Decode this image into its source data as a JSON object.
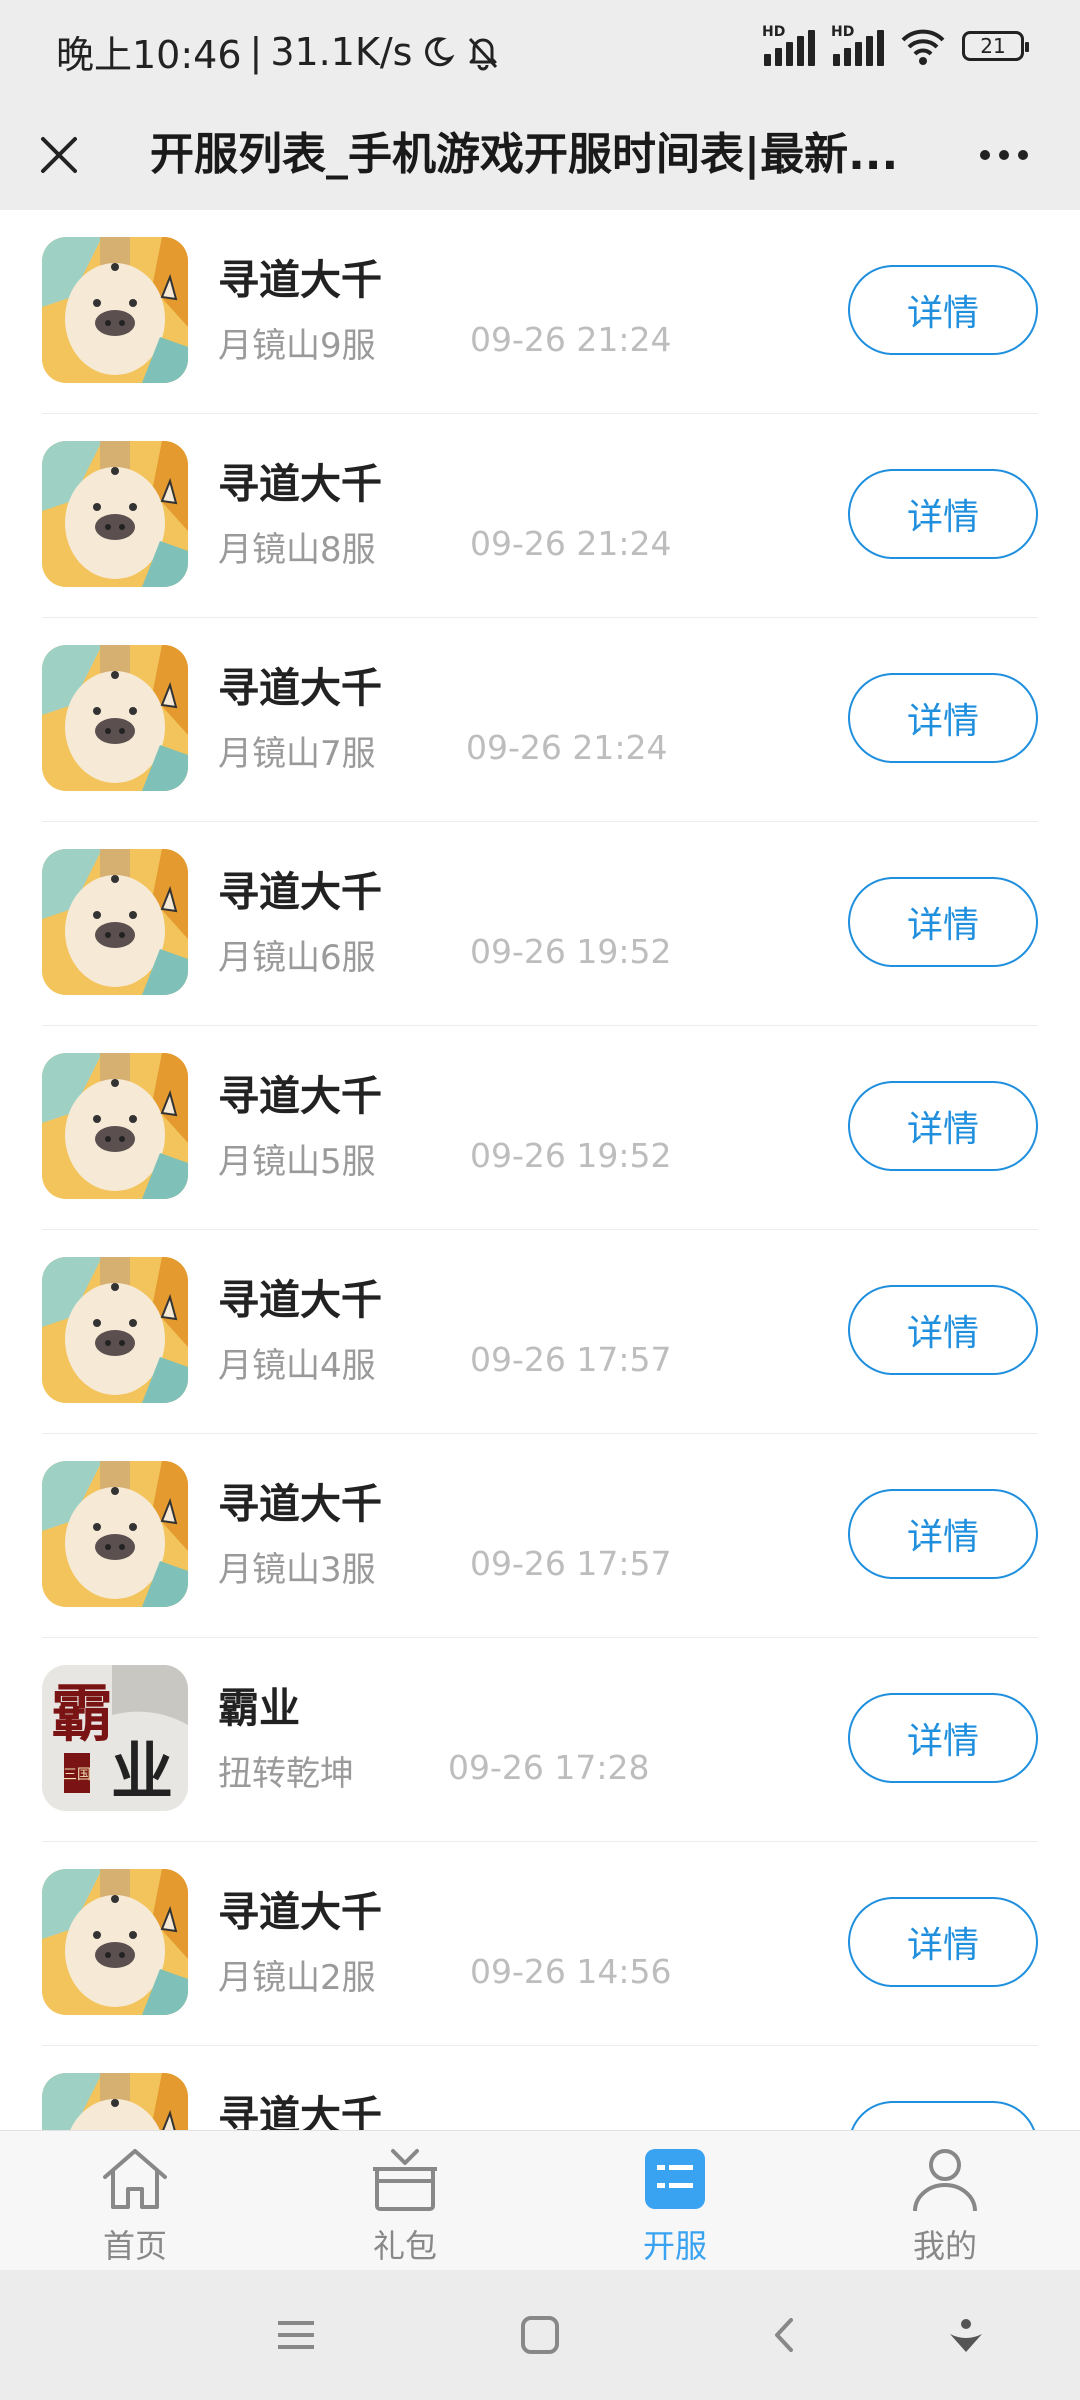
{
  "status_bar": {
    "time": "晚上10:46",
    "separator": "|",
    "net_speed": "31.1K/s",
    "signal_label_1": "HD",
    "signal_label_2": "HD",
    "battery": "21"
  },
  "title_bar": {
    "title": "开服列表_手机游戏开服时间表|最新..."
  },
  "list": {
    "detail_label": "详情",
    "items": [
      {
        "name": "寻道大千",
        "server": "月镜山9服",
        "time": "09-26 21:24",
        "icon": "pig-sage-game-icon"
      },
      {
        "name": "寻道大千",
        "server": "月镜山8服",
        "time": "09-26 21:24",
        "icon": "pig-sage-game-icon"
      },
      {
        "name": "寻道大千",
        "server": "月镜山7服",
        "time": "09-26 21:24",
        "icon": "pig-sage-game-icon"
      },
      {
        "name": "寻道大千",
        "server": "月镜山6服",
        "time": "09-26 19:52",
        "icon": "pig-sage-game-icon"
      },
      {
        "name": "寻道大千",
        "server": "月镜山5服",
        "time": "09-26 19:52",
        "icon": "pig-sage-game-icon"
      },
      {
        "name": "寻道大千",
        "server": "月镜山4服",
        "time": "09-26 17:57",
        "icon": "pig-sage-game-icon"
      },
      {
        "name": "寻道大千",
        "server": "月镜山3服",
        "time": "09-26 17:57",
        "icon": "pig-sage-game-icon"
      },
      {
        "name": "霸业",
        "server": "扭转乾坤",
        "time": "09-26 17:28",
        "icon": "baye-game-icon",
        "icon_text_1": "霸",
        "icon_text_2": "业",
        "icon_text_3": "三国"
      },
      {
        "name": "寻道大千",
        "server": "月镜山2服",
        "time": "09-26 14:56",
        "icon": "pig-sage-game-icon"
      },
      {
        "name": "寻道大千",
        "server": "",
        "time": "",
        "icon": "pig-sage-game-icon"
      }
    ]
  },
  "tab_bar": {
    "tabs": [
      {
        "label": "首页",
        "icon": "home-icon",
        "active": false
      },
      {
        "label": "礼包",
        "icon": "gift-icon",
        "active": false
      },
      {
        "label": "开服",
        "icon": "server-list-icon",
        "active": true
      },
      {
        "label": "我的",
        "icon": "profile-icon",
        "active": false
      }
    ]
  },
  "colors": {
    "accent": "#1f8fde",
    "active_tab": "#3aa3f1",
    "header_bg": "#ededed"
  }
}
